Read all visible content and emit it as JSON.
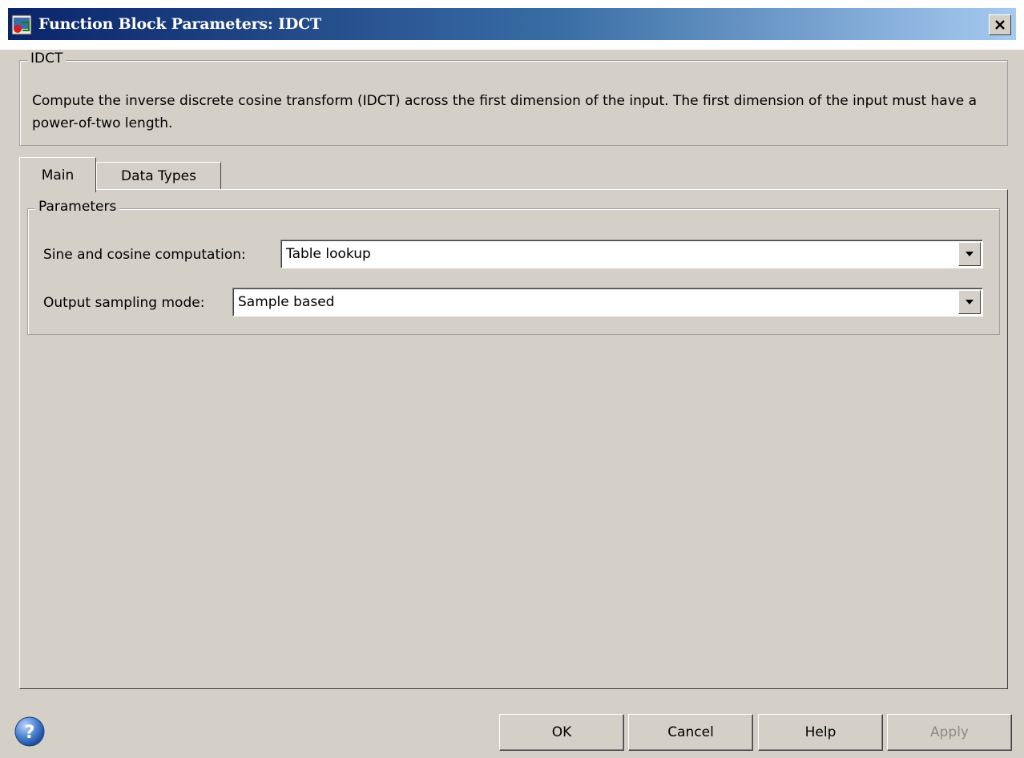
{
  "window": {
    "title": "Function Block Parameters: IDCT"
  },
  "description_group": {
    "legend": "IDCT",
    "text": "Compute the inverse discrete cosine transform (IDCT) across the first dimension of the input. The first dimension of the input must have a power-of-two length."
  },
  "tabs": [
    {
      "label": "Main",
      "selected": true
    },
    {
      "label": "Data Types",
      "selected": false
    }
  ],
  "parameters": {
    "legend": "Parameters",
    "sine_cosine": {
      "label": "Sine and cosine computation:",
      "value": "Table lookup"
    },
    "output_sampling": {
      "label": "Output sampling mode:",
      "value": "Sample based"
    }
  },
  "buttons": {
    "ok": "OK",
    "cancel": "Cancel",
    "help": "Help",
    "apply": "Apply"
  },
  "icons": {
    "title_icon": "simulink-block-icon",
    "close": "close-icon",
    "dropdown": "chevron-down-icon",
    "help": "help-question-icon"
  }
}
